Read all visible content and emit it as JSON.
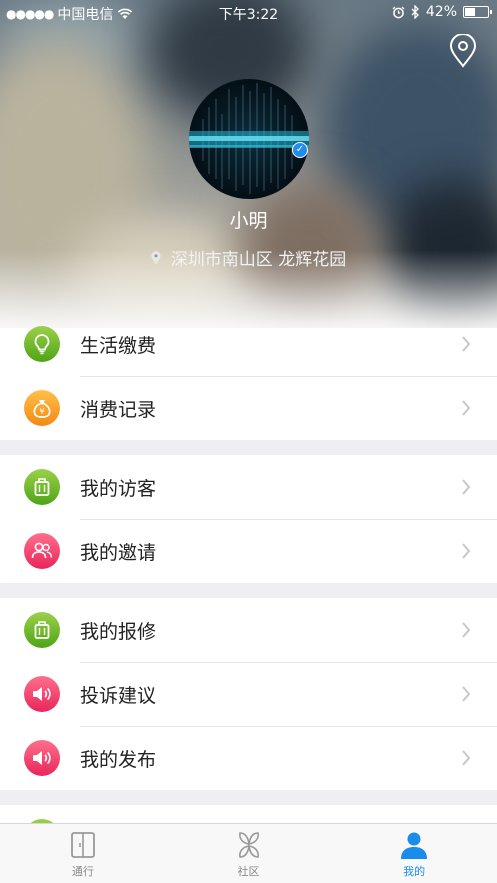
{
  "status_bar": {
    "carrier": "中国电信",
    "time": "下午3:22",
    "battery": "42%"
  },
  "profile": {
    "name": "小明",
    "address": "深圳市南山区 龙辉花园"
  },
  "menu_groups": [
    [
      {
        "label": "生活缴费",
        "icon": "lightbulb-icon",
        "color": "#6cbb2c"
      },
      {
        "label": "消费记录",
        "icon": "money-bag-icon",
        "color": "#f5a623"
      }
    ],
    [
      {
        "label": "我的访客",
        "icon": "suitcase-icon",
        "color": "#6cbb2c"
      },
      {
        "label": "我的邀请",
        "icon": "people-icon",
        "color": "#f03c6a"
      }
    ],
    [
      {
        "label": "我的报修",
        "icon": "suitcase-icon",
        "color": "#6cbb2c"
      },
      {
        "label": "投诉建议",
        "icon": "speaker-icon",
        "color": "#f03c6a"
      },
      {
        "label": "我的发布",
        "icon": "speaker-icon",
        "color": "#f03c6a"
      }
    ]
  ],
  "tabbar": {
    "tabs": [
      {
        "label": "通行",
        "icon": "door-icon",
        "active": false
      },
      {
        "label": "社区",
        "icon": "community-icon",
        "active": false
      },
      {
        "label": "我的",
        "icon": "user-icon",
        "active": true
      }
    ]
  },
  "colors": {
    "accent": "#1b8ceb",
    "green": "#6cbb2c",
    "orange": "#f5a623",
    "pink": "#f03c6a",
    "background": "#eeeef3"
  }
}
